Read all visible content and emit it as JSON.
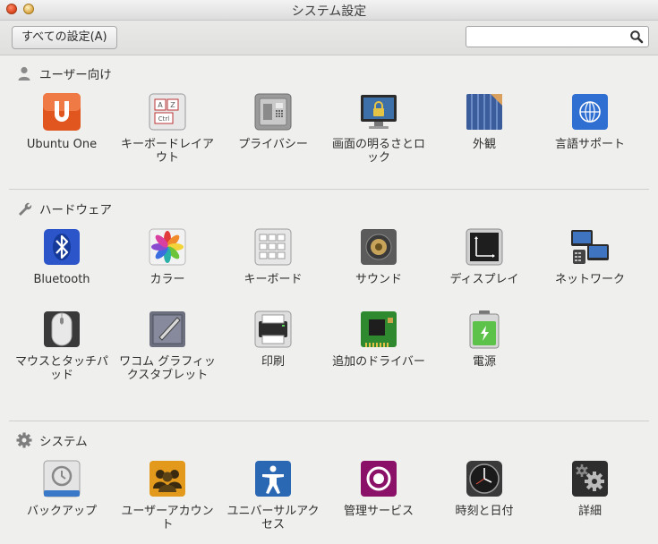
{
  "window": {
    "title": "システム設定"
  },
  "toolbar": {
    "all_settings_label": "すべての設定(A)",
    "search_value": "",
    "search_icon": "search-icon"
  },
  "sections": {
    "personal": {
      "title": "ユーザー向け",
      "items": [
        {
          "label": "Ubuntu One",
          "icon": "ubuntu-one-icon"
        },
        {
          "label": "キーボードレイアウト",
          "icon": "keyboard-layout-icon"
        },
        {
          "label": "プライバシー",
          "icon": "privacy-icon"
        },
        {
          "label": "画面の明るさとロック",
          "icon": "brightness-lock-icon"
        },
        {
          "label": "外観",
          "icon": "appearance-icon"
        },
        {
          "label": "言語サポート",
          "icon": "language-support-icon"
        }
      ]
    },
    "hardware": {
      "title": "ハードウェア",
      "items": [
        {
          "label": "Bluetooth",
          "icon": "bluetooth-icon"
        },
        {
          "label": "カラー",
          "icon": "color-icon"
        },
        {
          "label": "キーボード",
          "icon": "keyboard-icon"
        },
        {
          "label": "サウンド",
          "icon": "sound-icon"
        },
        {
          "label": "ディスプレイ",
          "icon": "display-icon"
        },
        {
          "label": "ネットワーク",
          "icon": "network-icon"
        },
        {
          "label": "マウスとタッチパッド",
          "icon": "mouse-touchpad-icon"
        },
        {
          "label": "ワコム グラフィックスタブレット",
          "icon": "wacom-tablet-icon"
        },
        {
          "label": "印刷",
          "icon": "printer-icon"
        },
        {
          "label": "追加のドライバー",
          "icon": "additional-drivers-icon"
        },
        {
          "label": "電源",
          "icon": "power-icon"
        }
      ]
    },
    "system": {
      "title": "システム",
      "items": [
        {
          "label": "バックアップ",
          "icon": "backup-icon"
        },
        {
          "label": "ユーザーアカウント",
          "icon": "user-accounts-icon"
        },
        {
          "label": "ユニバーサルアクセス",
          "icon": "universal-access-icon"
        },
        {
          "label": "管理サービス",
          "icon": "management-service-icon"
        },
        {
          "label": "時刻と日付",
          "icon": "time-date-icon"
        },
        {
          "label": "詳細",
          "icon": "details-icon"
        }
      ]
    }
  }
}
